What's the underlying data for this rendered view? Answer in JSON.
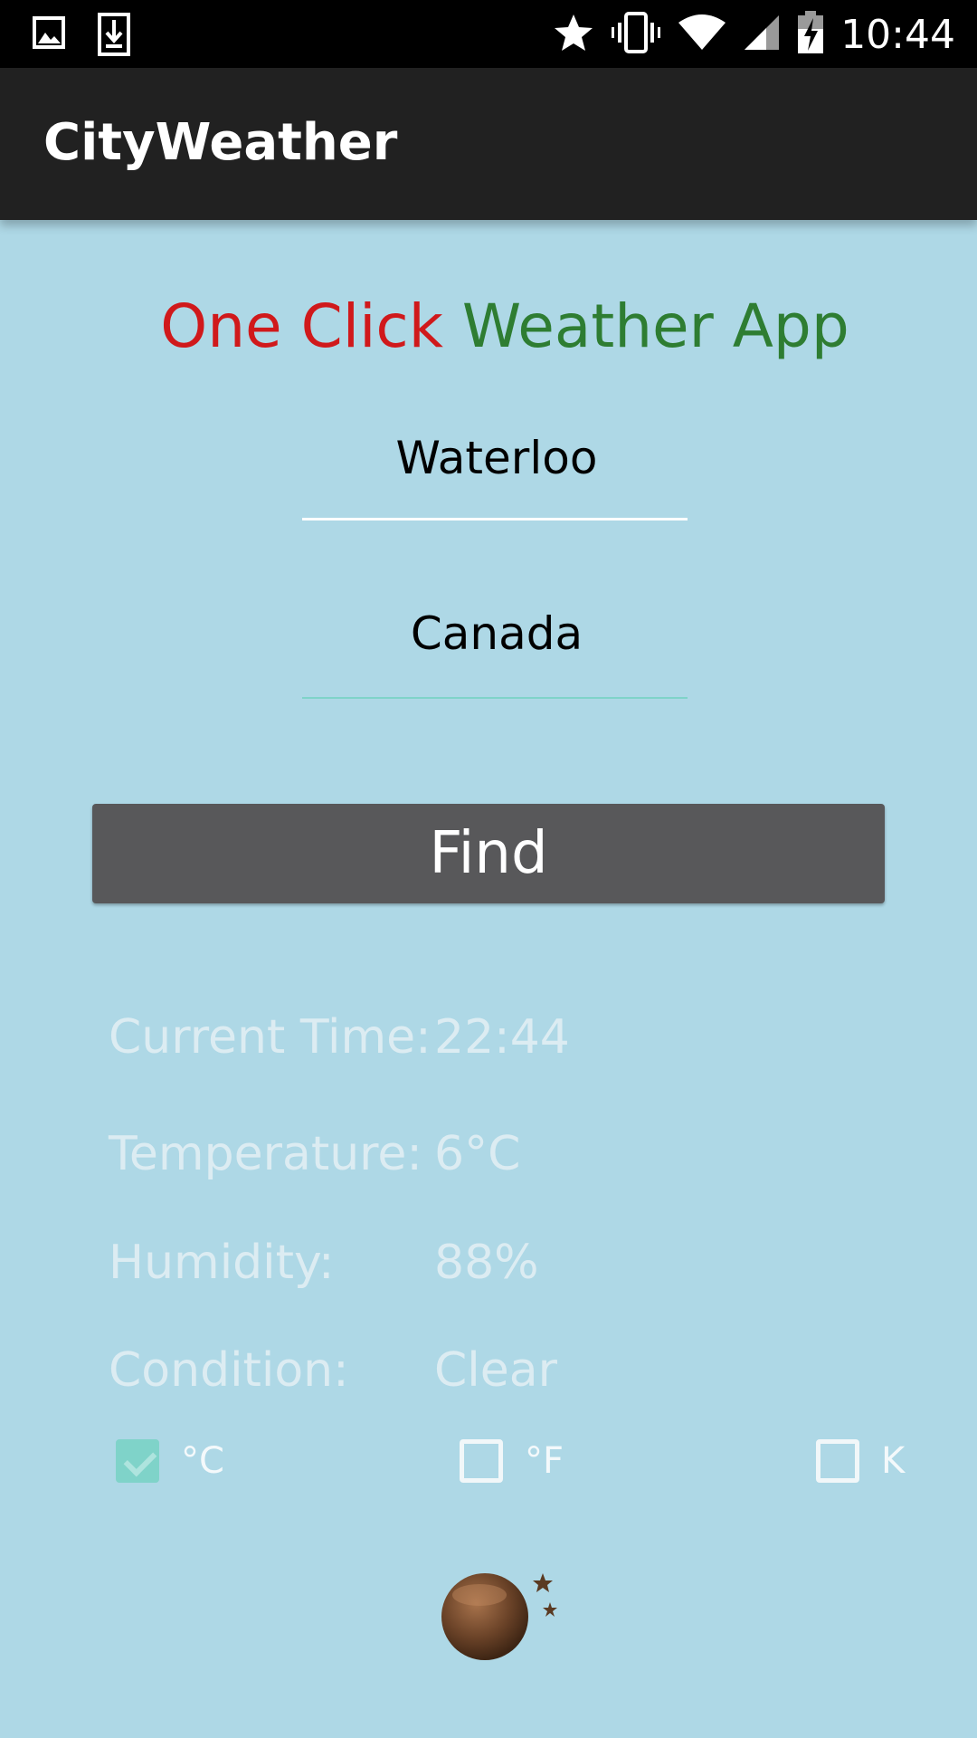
{
  "status_bar": {
    "time": "10:44",
    "left_icons": [
      "image-icon",
      "download-icon"
    ],
    "right_icons": [
      "star-icon",
      "vibrate-icon",
      "wifi-icon",
      "signal-icon",
      "battery-charging-icon"
    ]
  },
  "app_bar": {
    "title": "CityWeather"
  },
  "headline": {
    "part1": "One Click",
    "part2": "Weather App"
  },
  "form": {
    "city_value": "Waterloo",
    "country_value": "Canada",
    "find_label": "Find"
  },
  "info": {
    "time_label": "Current Time:",
    "time_value": "22:44",
    "temperature_label": "Temperature:",
    "temperature_value": "6°C",
    "humidity_label": "Humidity:",
    "humidity_value": "88%",
    "condition_label": "Condition:",
    "condition_value": "Clear"
  },
  "units": {
    "celsius_label": "°C",
    "fahrenheit_label": "°F",
    "kelvin_label": "K",
    "selected": "°C"
  },
  "condition_icon": "night-moon-stars-icon",
  "colors": {
    "background": "#aed8e6",
    "app_bar": "#212121",
    "headline_red": "#d0191b",
    "headline_green": "#2e7d32",
    "button": "#58585a",
    "accent": "#7fd3c9"
  }
}
